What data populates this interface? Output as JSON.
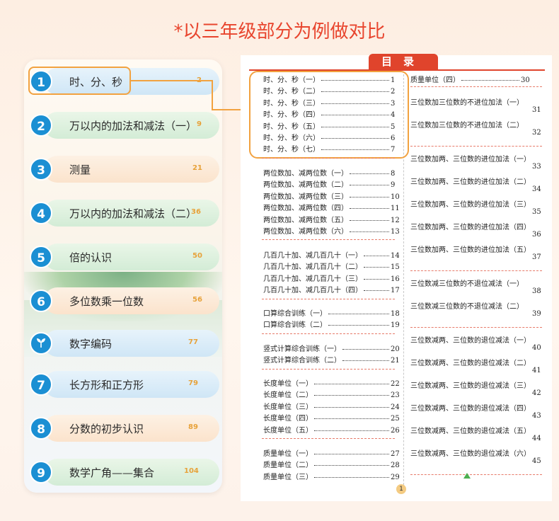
{
  "title": "*以三年级部分为例做对比",
  "toc_header": "目录",
  "page_number": "1",
  "units": [
    {
      "num": "1",
      "label": "时、分、秒",
      "page": "2",
      "style": "blue",
      "icon": ""
    },
    {
      "num": "2",
      "label": "万以内的加法和减法（一）",
      "page": "9",
      "style": "green",
      "icon": ""
    },
    {
      "num": "3",
      "label": "测量",
      "page": "21",
      "style": "orange",
      "icon": ""
    },
    {
      "num": "4",
      "label": "万以内的加法和减法（二）",
      "page": "36",
      "style": "green",
      "icon": ""
    },
    {
      "num": "5",
      "label": "倍的认识",
      "page": "50",
      "style": "green",
      "icon": ""
    },
    {
      "num": "6",
      "label": "多位数乘一位数",
      "page": "56",
      "style": "orange",
      "icon": ""
    },
    {
      "num": "",
      "label": "数字编码",
      "page": "77",
      "style": "blue",
      "icon": "sprout-icon"
    },
    {
      "num": "7",
      "label": "长方形和正方形",
      "page": "79",
      "style": "blue",
      "icon": ""
    },
    {
      "num": "8",
      "label": "分数的初步认识",
      "page": "89",
      "style": "orange",
      "icon": ""
    },
    {
      "num": "9",
      "label": "数学广角——集合",
      "page": "104",
      "style": "green",
      "icon": ""
    }
  ],
  "toc_left": [
    [
      {
        "t": "时、分、秒（一）",
        "p": "1"
      },
      {
        "t": "时、分、秒（二）",
        "p": "2"
      },
      {
        "t": "时、分、秒（三）",
        "p": "3"
      },
      {
        "t": "时、分、秒（四）",
        "p": "4"
      },
      {
        "t": "时、分、秒（五）",
        "p": "5"
      },
      {
        "t": "时、分、秒（六）",
        "p": "6"
      },
      {
        "t": "时、分、秒（七）",
        "p": "7"
      }
    ],
    [
      {
        "t": "两位数加、减两位数（一）",
        "p": "8"
      },
      {
        "t": "两位数加、减两位数（二）",
        "p": "9"
      },
      {
        "t": "两位数加、减两位数（三）",
        "p": "10"
      },
      {
        "t": "两位数加、减两位数（四）",
        "p": "11"
      },
      {
        "t": "两位数加、减两位数（五）",
        "p": "12"
      },
      {
        "t": "两位数加、减两位数（六）",
        "p": "13"
      }
    ],
    [
      {
        "t": "几百几十加、减几百几十（一）",
        "p": "14"
      },
      {
        "t": "几百几十加、减几百几十（二）",
        "p": "15"
      },
      {
        "t": "几百几十加、减几百几十（三）",
        "p": "16"
      },
      {
        "t": "几百几十加、减几百几十（四）",
        "p": "17"
      }
    ],
    [
      {
        "t": "口算综合训练（一）",
        "p": "18"
      },
      {
        "t": "口算综合训练（二）",
        "p": "19"
      }
    ],
    [
      {
        "t": "竖式计算综合训练（一）",
        "p": "20"
      },
      {
        "t": "竖式计算综合训练（二）",
        "p": "21"
      }
    ],
    [
      {
        "t": "长度单位（一）",
        "p": "22"
      },
      {
        "t": "长度单位（二）",
        "p": "23"
      },
      {
        "t": "长度单位（三）",
        "p": "24"
      },
      {
        "t": "长度单位（四）",
        "p": "25"
      },
      {
        "t": "长度单位（五）",
        "p": "26"
      }
    ],
    [
      {
        "t": "质量单位（一）",
        "p": "27"
      },
      {
        "t": "质量单位（二）",
        "p": "28"
      },
      {
        "t": "质量单位（三）",
        "p": "29"
      }
    ]
  ],
  "toc_right_top": {
    "t": "质量单位（四）",
    "p": "30"
  },
  "toc_right": [
    [
      {
        "t": "三位数加三位数的不进位加法（一）",
        "p": "31"
      },
      {
        "t": "三位数加三位数的不进位加法（二）",
        "p": "32"
      }
    ],
    [
      {
        "t": "三位数加两、三位数的进位加法（一）",
        "p": "33"
      },
      {
        "t": "三位数加两、三位数的进位加法（二）",
        "p": "34"
      },
      {
        "t": "三位数加两、三位数的进位加法（三）",
        "p": "35"
      },
      {
        "t": "三位数加两、三位数的进位加法（四）",
        "p": "36"
      },
      {
        "t": "三位数加两、三位数的进位加法（五）",
        "p": "37"
      }
    ],
    [
      {
        "t": "三位数减三位数的不退位减法（一）",
        "p": "38"
      },
      {
        "t": "三位数减三位数的不退位减法（二）",
        "p": "39"
      }
    ],
    [
      {
        "t": "三位数减两、三位数的退位减法（一）",
        "p": "40"
      },
      {
        "t": "三位数减两、三位数的退位减法（二）",
        "p": "41"
      },
      {
        "t": "三位数减两、三位数的退位减法（三）",
        "p": "42"
      },
      {
        "t": "三位数减两、三位数的退位减法（四）",
        "p": "43"
      },
      {
        "t": "三位数减两、三位数的退位减法（五）",
        "p": "44"
      },
      {
        "t": "三位数减两、三位数的退位减法（六）",
        "p": "45"
      }
    ]
  ],
  "colors": {
    "accent": "#e0442c",
    "highlight": "#f2a240",
    "circle": "#1b8fd3"
  }
}
